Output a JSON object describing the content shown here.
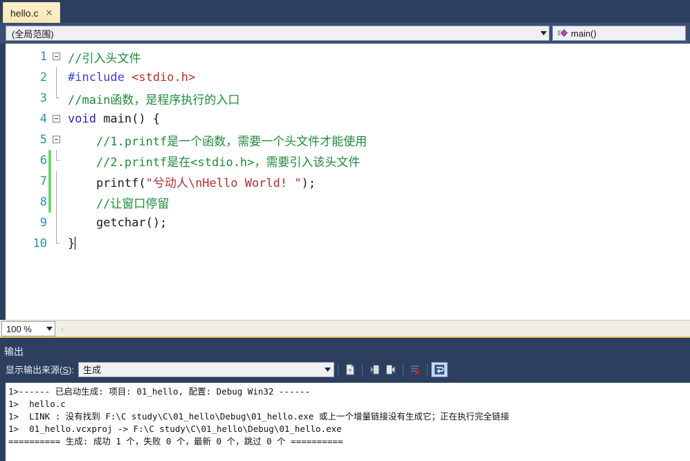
{
  "tab": {
    "label": "hello.c",
    "close_icon": "close-icon"
  },
  "navbar": {
    "scope_value": "(全局范围)",
    "member_value": "main()",
    "member_icon": "method-purple-icon"
  },
  "editor": {
    "lines": [
      {
        "num": "1",
        "tokens": [
          {
            "cls": "tk-comment",
            "text": "//引入头文件"
          }
        ]
      },
      {
        "num": "2",
        "tokens": [
          {
            "cls": "tk-pre",
            "text": "#include "
          },
          {
            "cls": "tk-str",
            "text": "<stdio.h>"
          }
        ]
      },
      {
        "num": "3",
        "tokens": [
          {
            "cls": "tk-comment",
            "text": "//main函数，是程序执行的入口"
          }
        ]
      },
      {
        "num": "4",
        "tokens": [
          {
            "cls": "tk-kw",
            "text": "void"
          },
          {
            "cls": "tk-plain",
            "text": " main() {"
          }
        ]
      },
      {
        "num": "5",
        "tokens": [
          {
            "cls": "tk-comment",
            "text": "    //1.printf是一个函数，需要一个头文件才能使用"
          }
        ]
      },
      {
        "num": "6",
        "tokens": [
          {
            "cls": "tk-comment",
            "text": "    //2.printf是在<stdio.h>，需要引入该头文件"
          }
        ]
      },
      {
        "num": "7",
        "tokens": [
          {
            "cls": "tk-plain",
            "text": "    printf("
          },
          {
            "cls": "tk-str",
            "text": "\"兮动人\\nHello World! \""
          },
          {
            "cls": "tk-plain",
            "text": ");"
          }
        ]
      },
      {
        "num": "8",
        "tokens": [
          {
            "cls": "tk-comment",
            "text": "    //让窗口停留"
          }
        ]
      },
      {
        "num": "9",
        "tokens": [
          {
            "cls": "tk-plain",
            "text": "    getchar();"
          }
        ]
      },
      {
        "num": "10",
        "tokens": [
          {
            "cls": "tk-plain",
            "text": "}"
          }
        ]
      }
    ]
  },
  "zoombar": {
    "zoom_level": "100 %",
    "chevron": "chevron-left-icon"
  },
  "output": {
    "title": "输出",
    "source_label_pre": "显示输出来源(",
    "source_label_key": "S",
    "source_label_post": "):",
    "source_value": "生成",
    "toolbar": [
      {
        "name": "find-message-in-code-button",
        "enabled": false
      },
      {
        "name": "go-to-previous-message-button",
        "enabled": false
      },
      {
        "name": "go-to-next-message-button",
        "enabled": false
      },
      {
        "name": "clear-all-button",
        "enabled": true
      },
      {
        "name": "toggle-word-wrap-button",
        "enabled": true,
        "active": true
      }
    ],
    "lines": [
      "1>------ 已启动生成: 项目: 01_hello, 配置: Debug Win32 ------",
      "1>  hello.c",
      "1>  LINK : 没有找到 F:\\C study\\C\\01_hello\\Debug\\01_hello.exe 或上一个增量链接没有生成它；正在执行完全链接",
      "1>  01_hello.vcxproj -> F:\\C study\\C\\01_hello\\Debug\\01_hello.exe",
      "========== 生成: 成功 1 个，失败 0 个，最新 0 个，跳过 0 个 =========="
    ]
  },
  "colors": {
    "chrome": "#2d3f5f",
    "accent_tab": "#fdf0cd",
    "splitter_accent": "#e8c95e",
    "comment": "#1f8a3c",
    "string": "#b03030",
    "keyword": "#2020c0",
    "preprocessor": "#3b41d6",
    "line_number": "#2b91af",
    "change_bar_saved": "#6fd46f"
  }
}
